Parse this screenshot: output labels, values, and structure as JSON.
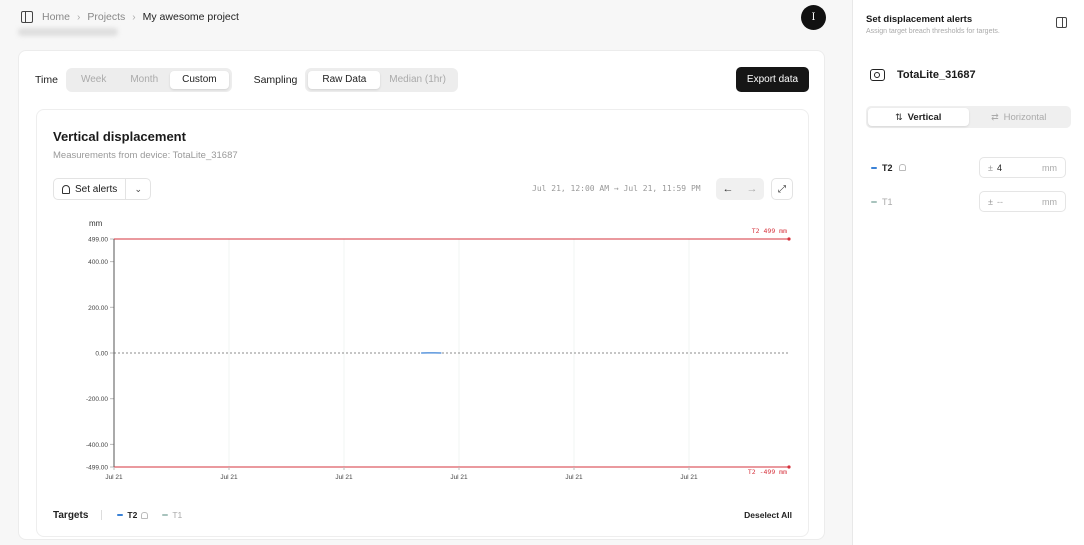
{
  "breadcrumb": {
    "items": [
      "Home",
      "Projects"
    ],
    "current": "My awesome project"
  },
  "avatar": {
    "initial": "I"
  },
  "controls": {
    "time_label": "Time",
    "time_options": [
      "Week",
      "Month",
      "Custom"
    ],
    "time_selected": "Custom",
    "sampling_label": "Sampling",
    "sampling_options": [
      "Raw Data",
      "Median (1hr)"
    ],
    "sampling_selected": "Raw Data",
    "export_label": "Export data"
  },
  "chart": {
    "title": "Vertical displacement",
    "subtitle": "Measurements from device: TotaLite_31687",
    "set_alerts_label": "Set alerts",
    "date_range": "Jul 21, 12:00 AM → Jul 21, 11:59 PM"
  },
  "chart_data": {
    "type": "line",
    "ylabel": "mm",
    "xlabel": "",
    "ylim": [
      -499,
      499
    ],
    "yticks": [
      499,
      400,
      200,
      0,
      -200,
      -400,
      -499
    ],
    "ytick_labels": [
      "499.00",
      "400.00",
      "200.00",
      "0.00",
      "-200.00",
      "-400.00",
      "-499.00"
    ],
    "xtick_labels": [
      "Jul 21",
      "Jul 21",
      "Jul 21",
      "Jul 21",
      "Jul 21",
      "Jul 21"
    ],
    "thresholds": [
      {
        "label": "T2 499 mm",
        "value": 499,
        "color": "#d6333d"
      },
      {
        "label": "T2 -499 mm",
        "value": -499,
        "color": "#d6333d"
      }
    ],
    "zero_line": true,
    "series": [
      {
        "name": "T2",
        "color": "#3b82d6",
        "x": [
          0.455,
          0.465,
          0.475,
          0.485
        ],
        "values": [
          0,
          0.5,
          0.5,
          0
        ]
      }
    ]
  },
  "targets": {
    "label": "Targets",
    "items": [
      {
        "name": "T2",
        "active": true,
        "color": "#3b82d6",
        "bell": true
      },
      {
        "name": "T1",
        "active": false,
        "color": "#a8c3bd",
        "bell": false
      }
    ],
    "deselect_label": "Deselect All"
  },
  "panel": {
    "title": "Set displacement alerts",
    "subtitle": "Assign target breach thresholds for targets.",
    "device_name": "TotaLite_31687",
    "orientation_options": [
      "Vertical",
      "Horizontal"
    ],
    "orientation_selected": "Vertical",
    "alerts": [
      {
        "name": "T2",
        "active": true,
        "color": "#3b82d6",
        "bell": true,
        "value": "4",
        "unit": "mm",
        "prefix": "±"
      },
      {
        "name": "T1",
        "active": false,
        "color": "#a8c3bd",
        "bell": false,
        "value": "--",
        "unit": "mm",
        "prefix": "±"
      }
    ]
  },
  "colors": {
    "accent_dark": "#161616",
    "threshold": "#d6333d",
    "t2": "#3b82d6"
  }
}
